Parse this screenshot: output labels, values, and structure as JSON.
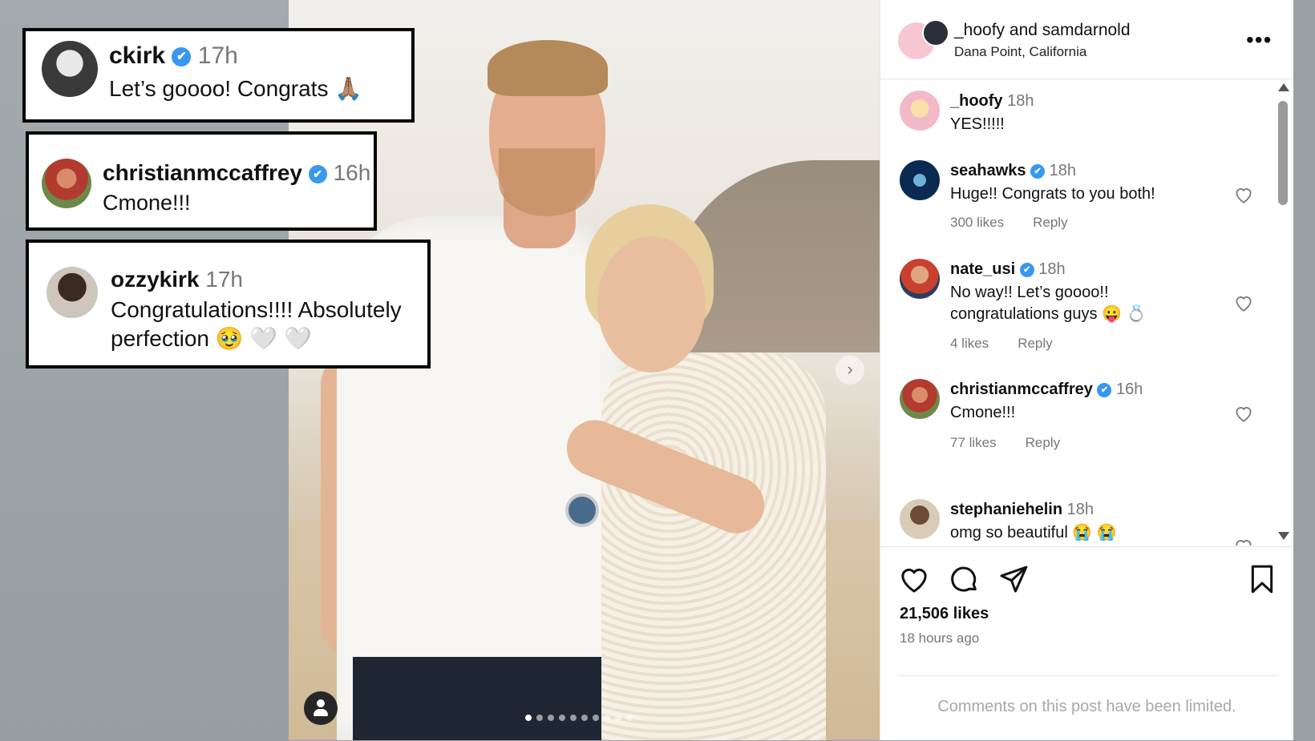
{
  "callouts": [
    {
      "user": "ckirk",
      "time": "17h",
      "text": "Let’s goooo! Congrats",
      "emoji": "🙏🏽"
    },
    {
      "user": "christianmccaffrey",
      "time": "16h",
      "text": "Cmone!!!",
      "emoji": ""
    },
    {
      "user": "ozzykirk",
      "time": "17h",
      "text_line1": "Congratulations!!!! Absolutely",
      "text_line2": "perfection",
      "emoji": "🥹 🤍 🤍"
    }
  ],
  "post": {
    "user1": "_hoofy",
    "joiner": "and",
    "user2": "samdarnold",
    "location": "Dana Point, California",
    "more": "•••",
    "likes": "21,506 likes",
    "ago": "18 hours ago",
    "limited_notice": "Comments on this post have been limited."
  },
  "comments": [
    {
      "user": "_hoofy",
      "time": "18h",
      "text": "YES!!!!!",
      "likes": "",
      "reply": ""
    },
    {
      "user": "seahawks",
      "time": "18h",
      "text": "Huge!! Congrats to you both!",
      "likes": "300 likes",
      "reply": "Reply"
    },
    {
      "user": "nate_usi",
      "time": "18h",
      "text": "No way!! Let’s goooo!!",
      "text2": "congratulations guys 😛 💍",
      "likes": "4 likes",
      "reply": "Reply"
    },
    {
      "user": "christianmccaffrey",
      "time": "16h",
      "text": "Cmone!!!",
      "likes": "77 likes",
      "reply": "Reply"
    },
    {
      "user": "stephaniehelin",
      "time": "18h",
      "text": "omg so beautiful 😭 😭",
      "likes": "",
      "reply": ""
    }
  ],
  "icons": {
    "verified": "✔",
    "next": "›"
  },
  "colors": {
    "verified": "#3897f0",
    "muted": "#777777"
  }
}
